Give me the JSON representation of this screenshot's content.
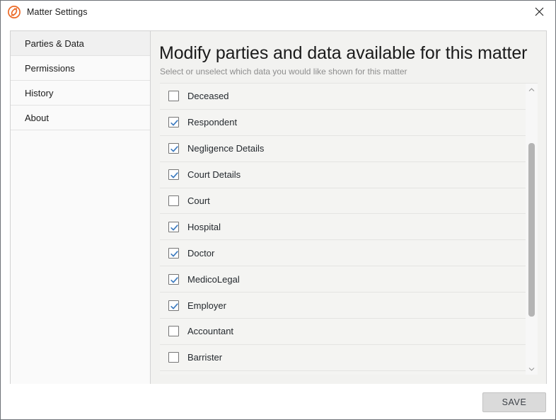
{
  "window": {
    "title": "Matter Settings",
    "app_icon": "spiral-s-logo-icon",
    "accent_color": "#ec6a27",
    "close_label": "✕"
  },
  "sidebar": {
    "items": [
      {
        "label": "Parties & Data",
        "selected": true
      },
      {
        "label": "Permissions",
        "selected": false
      },
      {
        "label": "History",
        "selected": false
      },
      {
        "label": "About",
        "selected": false
      }
    ]
  },
  "main": {
    "heading": "Modify parties and data available for this matter",
    "subheading": "Select or unselect which data you would like shown for this matter",
    "list": [
      {
        "label": "Deceased",
        "checked": false
      },
      {
        "label": "Respondent",
        "checked": true
      },
      {
        "label": "Negligence Details",
        "checked": true
      },
      {
        "label": "Court Details",
        "checked": true
      },
      {
        "label": "Court",
        "checked": false
      },
      {
        "label": "Hospital",
        "checked": true
      },
      {
        "label": "Doctor",
        "checked": true
      },
      {
        "label": "MedicoLegal",
        "checked": true
      },
      {
        "label": "Employer",
        "checked": true
      },
      {
        "label": "Accountant",
        "checked": false
      },
      {
        "label": "Barrister",
        "checked": false
      }
    ],
    "scrollbar": {
      "up_arrow_icon": "chevron-up-icon",
      "down_arrow_icon": "chevron-down-icon",
      "thumb_color": "#b4b4b4"
    },
    "checkbox_check_color": "#3d7bbf"
  },
  "footer": {
    "save_label": "SAVE"
  }
}
